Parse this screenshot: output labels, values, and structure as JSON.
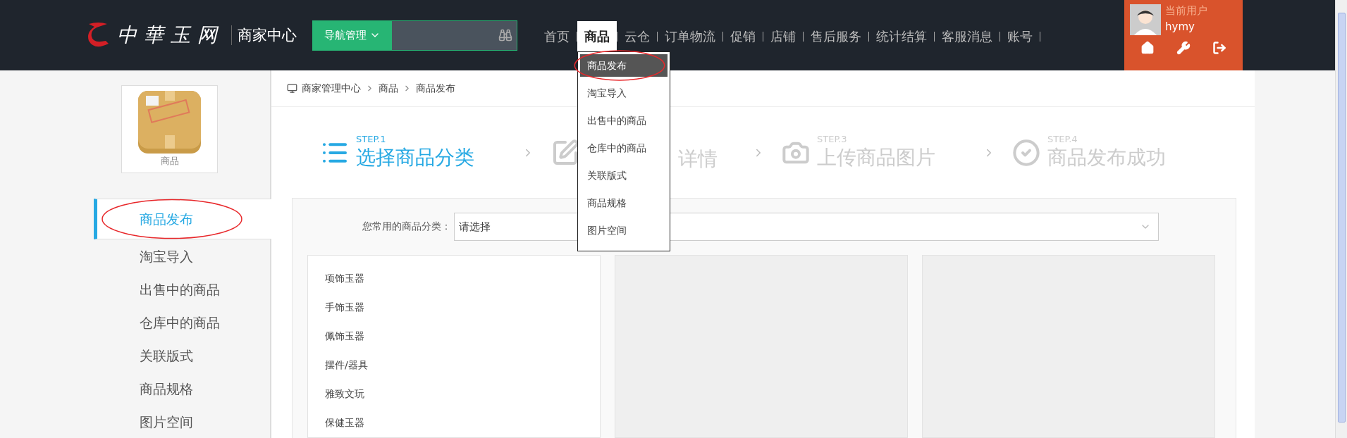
{
  "logo": {
    "name": "中華玉网",
    "subtitle": "商家中心"
  },
  "nav_manage": {
    "label": "导航管理"
  },
  "nav": [
    {
      "label": "首页",
      "selected": false
    },
    {
      "label": "商品",
      "selected": true
    },
    {
      "label": "云仓",
      "selected": false
    },
    {
      "label": "订单物流",
      "selected": false
    },
    {
      "label": "促销",
      "selected": false
    },
    {
      "label": "店铺",
      "selected": false
    },
    {
      "label": "售后服务",
      "selected": false
    },
    {
      "label": "统计结算",
      "selected": false
    },
    {
      "label": "客服消息",
      "selected": false
    },
    {
      "label": "账号",
      "selected": false
    }
  ],
  "nav_dropdown": [
    {
      "label": "商品发布",
      "selected": true,
      "circled": true
    },
    {
      "label": "淘宝导入",
      "selected": false,
      "circled": false
    },
    {
      "label": "出售中的商品",
      "selected": false,
      "circled": false
    },
    {
      "label": "仓库中的商品",
      "selected": false,
      "circled": false
    },
    {
      "label": "关联版式",
      "selected": false,
      "circled": false
    },
    {
      "label": "商品规格",
      "selected": false,
      "circled": false
    },
    {
      "label": "图片空间",
      "selected": false,
      "circled": false
    }
  ],
  "user": {
    "caption": "当前用户",
    "name": "hymy"
  },
  "sidebar": {
    "card_label": "商品",
    "items": [
      {
        "label": "商品发布",
        "selected": true,
        "circled": true
      },
      {
        "label": "淘宝导入",
        "selected": false,
        "circled": false
      },
      {
        "label": "出售中的商品",
        "selected": false,
        "circled": false
      },
      {
        "label": "仓库中的商品",
        "selected": false,
        "circled": false
      },
      {
        "label": "关联版式",
        "selected": false,
        "circled": false
      },
      {
        "label": "商品规格",
        "selected": false,
        "circled": false
      },
      {
        "label": "图片空间",
        "selected": false,
        "circled": false
      }
    ]
  },
  "breadcrumb": [
    "商家管理中心",
    "商品",
    "商品发布"
  ],
  "steps": [
    {
      "kind": "list",
      "label": "STEP.1",
      "title": "选择商品分类",
      "current": true
    },
    {
      "kind": "edit",
      "title": "详情",
      "current": false
    },
    {
      "kind": "camera",
      "label": "STEP.3",
      "title": "上传商品图片",
      "current": false
    },
    {
      "kind": "check",
      "label": "STEP.4",
      "title": "商品发布成功",
      "current": false
    }
  ],
  "category_select": {
    "label": "您常用的商品分类：",
    "value": "请选择"
  },
  "categories": [
    "项饰玉器",
    "手饰玉器",
    "佩饰玉器",
    "摆件/器具",
    "雅致文玩",
    "保健玉器"
  ]
}
